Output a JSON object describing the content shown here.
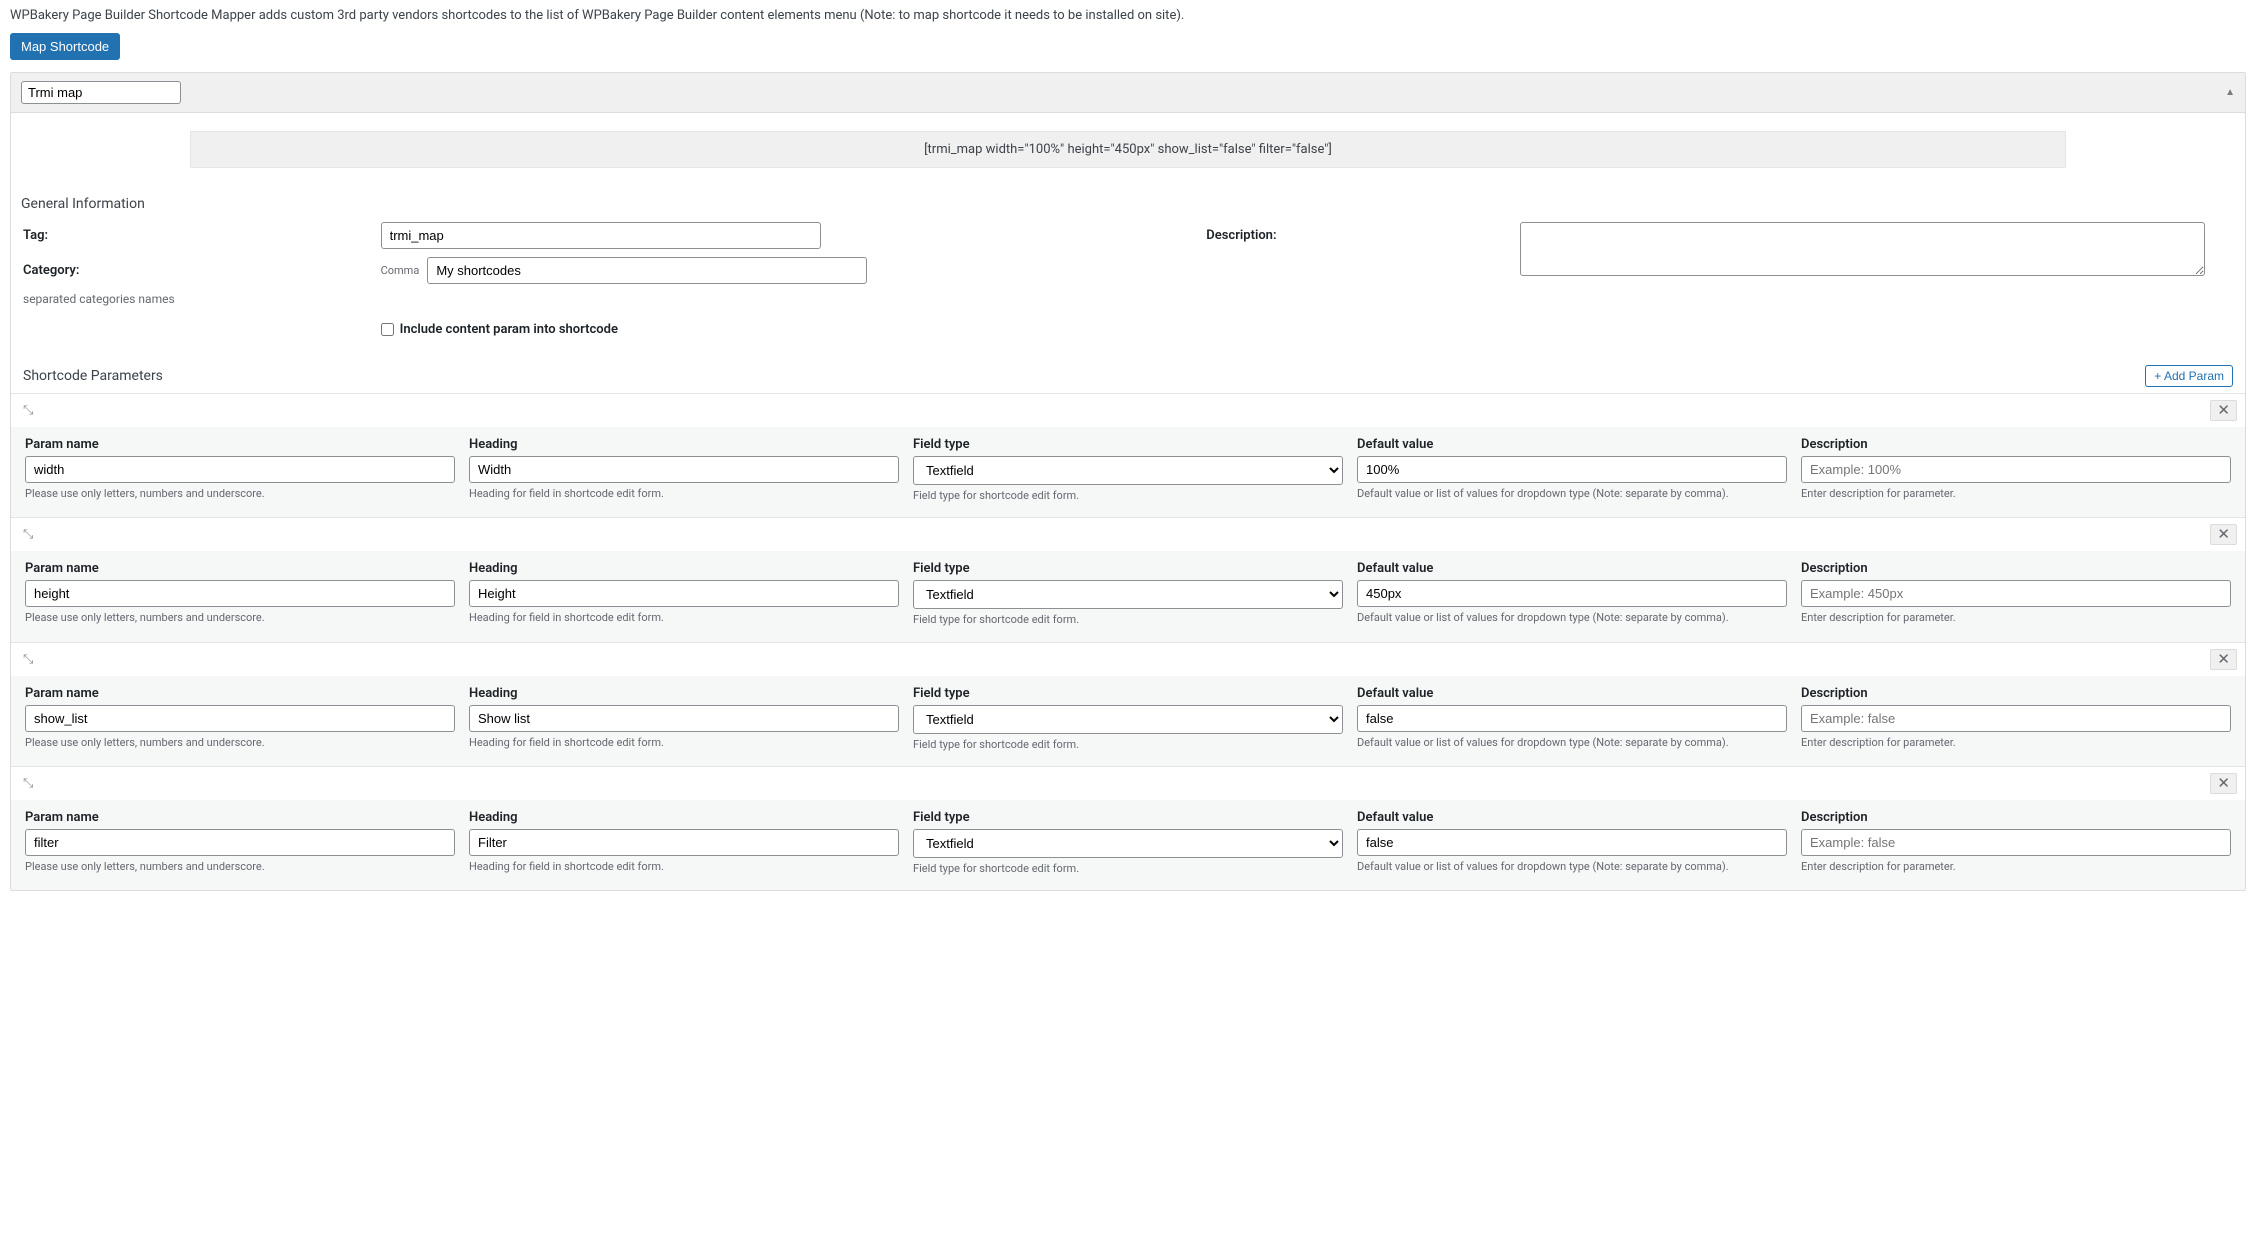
{
  "intro": "WPBakery Page Builder Shortcode Mapper adds custom 3rd party vendors shortcodes to the list of WPBakery Page Builder content elements menu (Note: to map shortcode it needs to be installed on site).",
  "map_button": "Map Shortcode",
  "shortcode_title": "Trmi map",
  "shortcode_preview": "[trmi_map width=\"100%\" height=\"450px\" show_list=\"false\" filter=\"false\"]",
  "general": {
    "title": "General Information",
    "tag_label": "Tag:",
    "tag_value": "trmi_map",
    "category_label": "Category:",
    "category_prefix": "Comma",
    "category_value": "My shortcodes",
    "category_hint": "separated categories names",
    "description_label": "Description:",
    "description_value": "",
    "include_content_label": "Include content param into shortcode"
  },
  "params_section": {
    "title": "Shortcode Parameters",
    "add_label": "+ Add Param",
    "col_param_name": "Param name",
    "col_heading": "Heading",
    "col_field_type": "Field type",
    "col_default_value": "Default value",
    "col_description": "Description",
    "hint_param_name": "Please use only letters, numbers and underscore.",
    "hint_heading": "Heading for field in shortcode edit form.",
    "hint_field_type": "Field type for shortcode edit form.",
    "hint_default_value": "Default value or list of values for dropdown type (Note: separate by comma).",
    "hint_description": "Enter description for parameter.",
    "field_type_option": "Textfield"
  },
  "params": [
    {
      "name": "width",
      "heading": "Width",
      "default": "100%",
      "desc_placeholder": "Example: 100%"
    },
    {
      "name": "height",
      "heading": "Height",
      "default": "450px",
      "desc_placeholder": "Example: 450px"
    },
    {
      "name": "show_list",
      "heading": "Show list",
      "default": "false",
      "desc_placeholder": "Example: false"
    },
    {
      "name": "filter",
      "heading": "Filter",
      "default": "false",
      "desc_placeholder": "Example: false"
    }
  ]
}
